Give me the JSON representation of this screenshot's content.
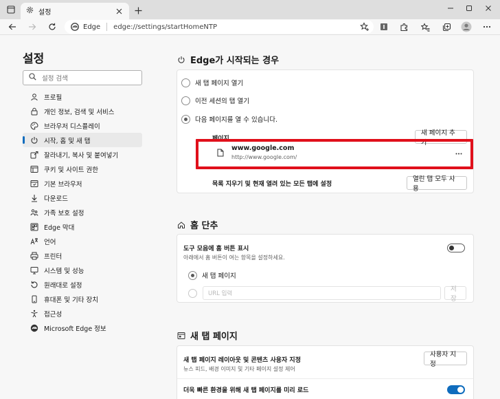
{
  "tabbar": {
    "tab_title": "설정"
  },
  "address": {
    "origin": "Edge",
    "url": "edge://settings/startHomeNTP"
  },
  "sidebar": {
    "title": "설정",
    "search_placeholder": "설정 검색",
    "items": [
      {
        "label": "프로필",
        "icon": "profile-icon"
      },
      {
        "label": "개인 정보, 검색 및 서비스",
        "icon": "lock-icon"
      },
      {
        "label": "브라우저 디스플레이",
        "icon": "palette-icon"
      },
      {
        "label": "시작, 홈 및 새 탭",
        "icon": "power-icon"
      },
      {
        "label": "잘라내기, 복사 및 붙여넣기",
        "icon": "share-icon"
      },
      {
        "label": "쿠키 및 사이트 권한",
        "icon": "cookie-icon"
      },
      {
        "label": "기본 브라우저",
        "icon": "browser-icon"
      },
      {
        "label": "다운로드",
        "icon": "download-icon"
      },
      {
        "label": "가족 보호 설정",
        "icon": "family-icon"
      },
      {
        "label": "Edge 막대",
        "icon": "edge-bar-icon"
      },
      {
        "label": "언어",
        "icon": "language-icon"
      },
      {
        "label": "프린터",
        "icon": "printer-icon"
      },
      {
        "label": "시스템 및 성능",
        "icon": "system-icon"
      },
      {
        "label": "원래대로 설정",
        "icon": "reset-icon"
      },
      {
        "label": "휴대폰 및 기타 장치",
        "icon": "phone-icon"
      },
      {
        "label": "접근성",
        "icon": "accessibility-icon"
      },
      {
        "label": "Microsoft Edge 정보",
        "icon": "edge-logo-icon"
      }
    ]
  },
  "startup": {
    "title": "Edge가 시작되는 경우",
    "option_new_tab": "새 탭 페이지 열기",
    "option_prev_session": "이전 세션의 탭 열기",
    "option_open_pages": "다음 페이지를 열 수 있습니다.",
    "pages_label": "페이지",
    "add_page_button": "새 페이지 추가",
    "page_name": "www.google.com",
    "page_url": "http://www.google.com/",
    "set_open_tabs_label": "목록 지우기 및 현재 열려 있는 모든 탭에 설정",
    "use_open_tabs_button": "열린 탭 모두 사용"
  },
  "home": {
    "title": "홈 단추",
    "show_home_label": "도구 모음에 홈 버튼 표시",
    "show_home_desc": "아래에서 홈 버튼이 여는 항목을 설정하세요.",
    "option_new_tab": "새 탭 페이지",
    "url_placeholder": "URL 입력",
    "save_button": "저장"
  },
  "newtab": {
    "title": "새 탭 페이지",
    "customize_label": "새 탭 페이지 레이아웃 및 콘텐츠 사용자 지정",
    "customize_desc": "뉴스 피드, 배경 이미지 및 기타 페이지 설정 제어",
    "customize_button": "사용자 지정",
    "preload_label": "더욱 빠른 환경을 위해 새 탭 페이지를 미리 로드"
  },
  "colors": {
    "accent": "#0f6cbd",
    "highlight": "#e0101b"
  }
}
